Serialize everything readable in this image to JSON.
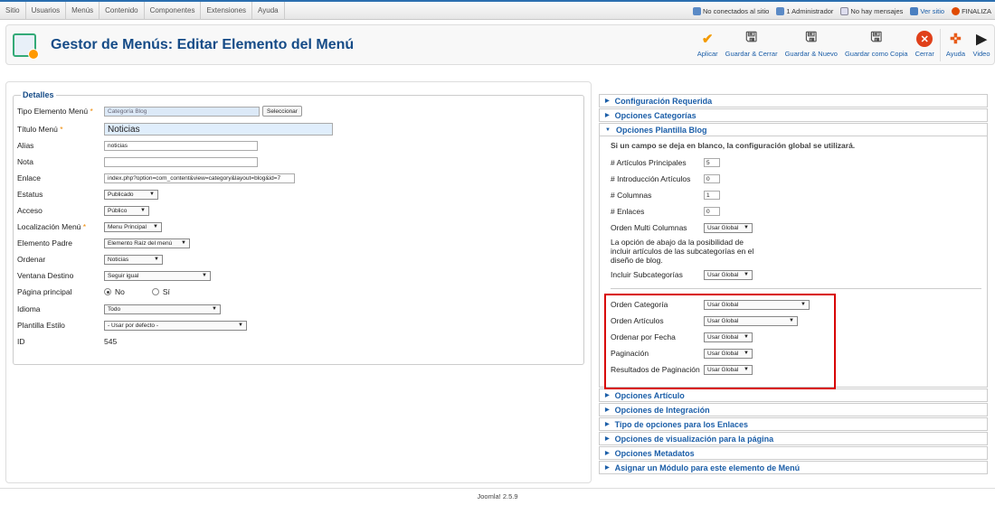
{
  "topmenu": [
    "Sitio",
    "Usuarios",
    "Menús",
    "Contenido",
    "Componentes",
    "Extensiones",
    "Ayuda"
  ],
  "status": {
    "visitors": "No conectados al sitio",
    "admins": "1 Administrador",
    "messages": "No hay mensajes",
    "view_site": "Ver sitio",
    "logout": "FINALIZA"
  },
  "page_title": "Gestor de Menús: Editar Elemento del Menú",
  "toolbar": {
    "apply": "Aplicar",
    "save_close": "Guardar & Cerrar",
    "save_new": "Guardar & Nuevo",
    "save_copy": "Guardar como Copia",
    "close": "Cerrar",
    "help": "Ayuda",
    "video": "Video"
  },
  "details": {
    "legend": "Detalles",
    "tipo_label": "Tipo Elemento Menú",
    "tipo_value": "Categoría Blog",
    "select_button": "Seleccionar",
    "titulo_label": "Título Menú",
    "titulo_value": "Noticias",
    "alias_label": "Alias",
    "alias_value": "noticias",
    "nota_label": "Nota",
    "nota_value": "",
    "enlace_label": "Enlace",
    "enlace_value": "index.php?option=com_content&view=category&layout=blog&id=7",
    "estatus_label": "Estatus",
    "estatus_value": "Publicado",
    "acceso_label": "Acceso",
    "acceso_value": "Público",
    "localizacion_label": "Localización Menú",
    "localizacion_value": "Menu Principal",
    "padre_label": "Elemento Padre",
    "padre_value": "Elemento Raíz del menú",
    "ordenar_label": "Ordenar",
    "ordenar_value": "Noticias",
    "ventana_label": "Ventana Destino",
    "ventana_value": "Seguir igual",
    "pagina_label": "Página principal",
    "pagina_no": "No",
    "pagina_si": "Sí",
    "idioma_label": "Idioma",
    "idioma_value": "Todo",
    "plantilla_label": "Plantilla Estilo",
    "plantilla_value": "- Usar por defecto -",
    "id_label": "ID",
    "id_value": "545"
  },
  "accordion_top": [
    "Configuración Requerida",
    "Opciones Categorías",
    "Opciones Plantilla Blog"
  ],
  "blog": {
    "note": "Si un campo se deja en blanco, la configuración global se utilizará.",
    "principales_label": "# Artículos Principales",
    "principales_value": "5",
    "introduccion_label": "# Introducción Artículos",
    "introduccion_value": "0",
    "columnas_label": "# Columnas",
    "columnas_value": "1",
    "enlaces_label": "# Enlaces",
    "enlaces_value": "0",
    "multi_label": "Orden Multi Columnas",
    "multi_value": "Usar Global",
    "sub_note_1": "La opción de abajo da la posibilidad de",
    "sub_note_2": "incluir artículos de las subcategorías en el",
    "sub_note_3": "diseño de blog.",
    "sub_label": "Incluir Subcategorías",
    "sub_value": "Usar Global",
    "cat_order_label": "Orden Categoría",
    "cat_order_value": "Usar Global",
    "art_order_label": "Orden Artículos",
    "art_order_value": "Usar Global",
    "date_order_label": "Ordenar por Fecha",
    "date_order_value": "Usar Global",
    "pag_label": "Paginación",
    "pag_value": "Usar Global",
    "pag_res_label": "Resultados de Paginación",
    "pag_res_value": "Usar Global"
  },
  "accordion_bottom": [
    "Opciones Artículo",
    "Opciones de Integración",
    "Tipo de opciones para los Enlaces",
    "Opciones de visualización para la página",
    "Opciones Metadatos",
    "Asignar un Módulo para este elemento de Menú"
  ],
  "footer": "Joomla! 2.5.9"
}
